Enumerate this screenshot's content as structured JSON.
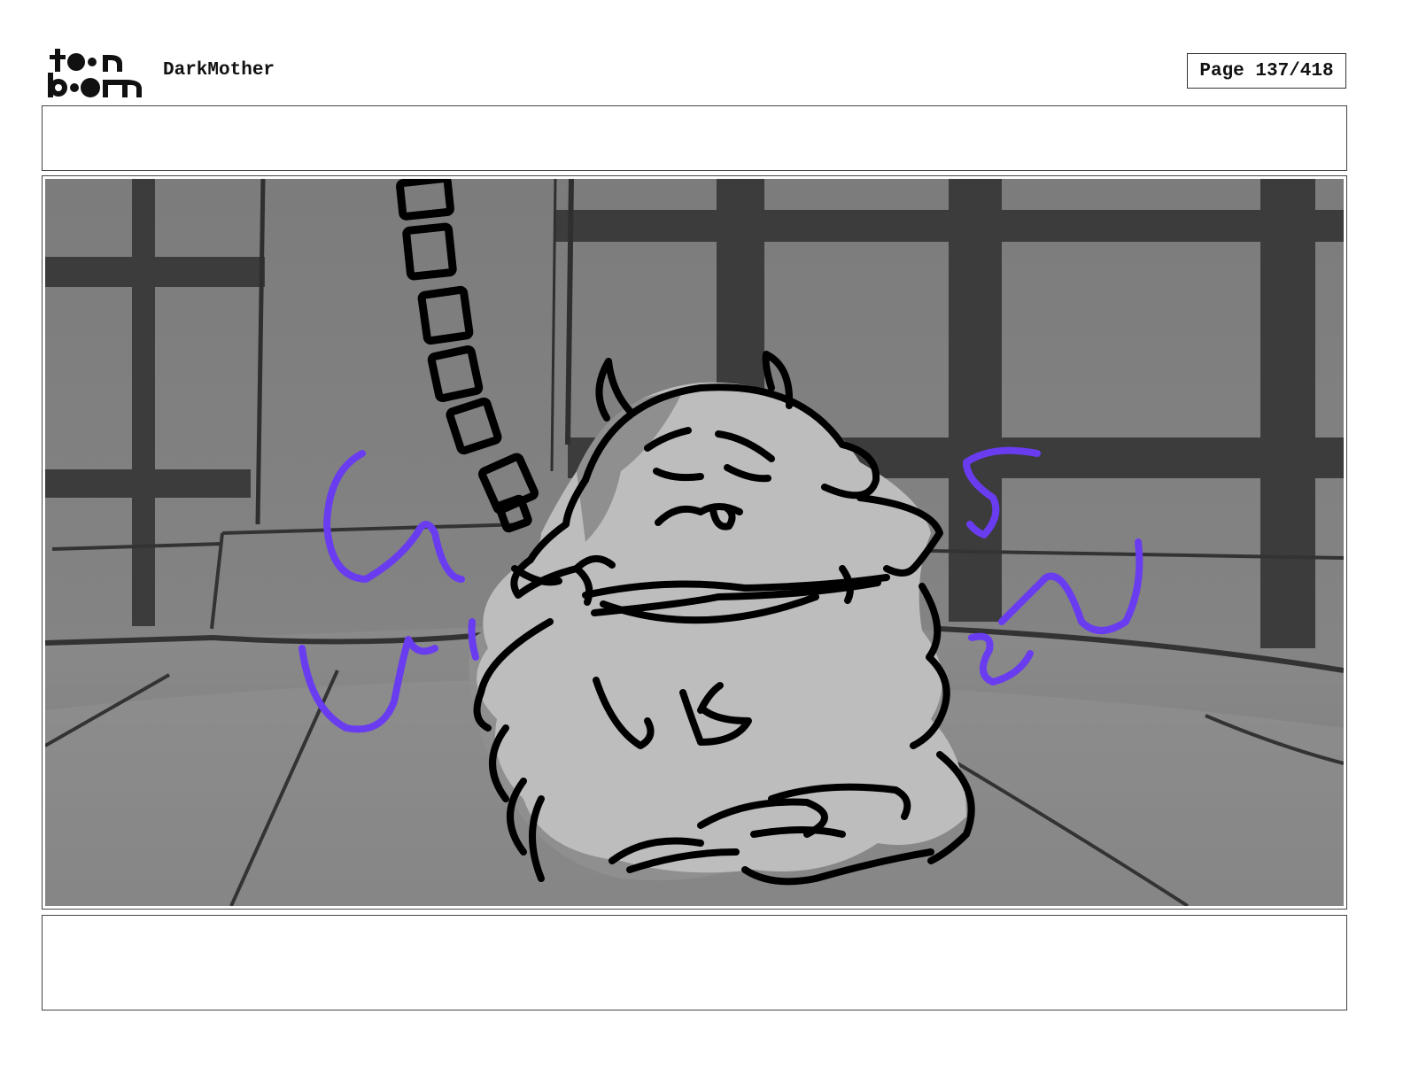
{
  "header": {
    "logo_alt": "toon boom",
    "project_title": "DarkMother",
    "page_label": "Page 137/418"
  },
  "captions": {
    "top_text": "",
    "bottom_text": ""
  },
  "panel": {
    "icon": "storyboard-panel-sketch",
    "colors": {
      "ink": "#000000",
      "accent_scribble": "#6a3cf0",
      "wall_gray": "#7f7f7f",
      "bar_dark": "#3c3c3c",
      "floor_gray": "#8c8c8c",
      "creature_light": "#bdbdbd",
      "creature_shadow": "#8f8f8f"
    }
  }
}
